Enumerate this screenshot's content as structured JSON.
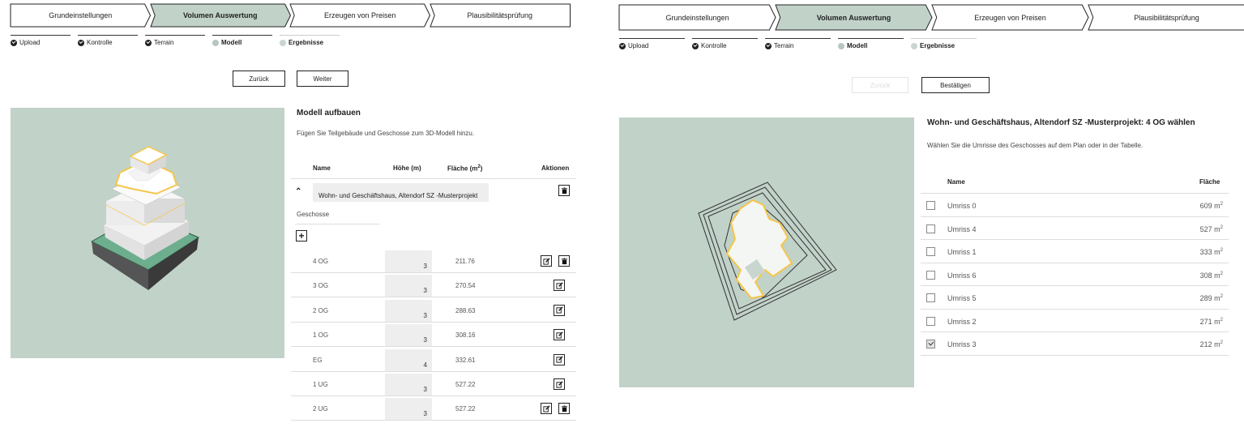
{
  "left": {
    "steps": [
      "Grundeinstellungen",
      "Volumen Auswertung",
      "Erzeugen von Preisen",
      "Plausibilitätsprüfung"
    ],
    "substeps": [
      {
        "label": "Upload",
        "state": "done"
      },
      {
        "label": "Kontrolle",
        "state": "done"
      },
      {
        "label": "Terrain",
        "state": "done"
      },
      {
        "label": "Modell",
        "state": "current"
      },
      {
        "label": "Ergebnisse",
        "state": "pending"
      }
    ],
    "back_label": "Zurück",
    "next_label": "Weiter",
    "title": "Modell aufbauen",
    "description": "Fügen Sie Teilgebäude und Geschosse zum 3D-Modell hinzu.",
    "columns": {
      "name": "Name",
      "height": "Höhe (m)",
      "area": "Fläche (m",
      "area_sup": "2",
      "area_close": ")",
      "actions": "Aktionen"
    },
    "building_name": "Wohn- und Geschäftshaus, Altendorf SZ -Musterprojekt",
    "floors_label": "Geschosse",
    "floors": [
      {
        "name": "4 OG",
        "height": "3",
        "area": "211.76",
        "delete": true
      },
      {
        "name": "3 OG",
        "height": "3",
        "area": "270.54",
        "delete": false
      },
      {
        "name": "2 OG",
        "height": "3",
        "area": "288.63",
        "delete": false
      },
      {
        "name": "1 OG",
        "height": "3",
        "area": "308.16",
        "delete": false
      },
      {
        "name": "EG",
        "height": "4",
        "area": "332.61",
        "delete": false
      },
      {
        "name": "1 UG",
        "height": "3",
        "area": "527.22",
        "delete": false
      },
      {
        "name": "2 UG",
        "height": "3",
        "area": "527.22",
        "delete": true
      }
    ]
  },
  "right": {
    "steps": [
      "Grundeinstellungen",
      "Volumen Auswertung",
      "Erzeugen von Preisen",
      "Plausibilitätsprüfung"
    ],
    "substeps": [
      {
        "label": "Upload",
        "state": "done"
      },
      {
        "label": "Kontrolle",
        "state": "done"
      },
      {
        "label": "Terrain",
        "state": "done"
      },
      {
        "label": "Modell",
        "state": "current"
      },
      {
        "label": "Ergebnisse",
        "state": "pending"
      }
    ],
    "back_label": "Zurück",
    "confirm_label": "Bestätigen",
    "title": "Wohn- und Geschäftshaus, Altendorf SZ -Musterprojekt: 4 OG wählen",
    "description": "Wählen Sie die Umrisse des Geschosses auf dem Plan oder in der Tabelle.",
    "columns": {
      "name": "Name",
      "area": "Fläche"
    },
    "unit": "m",
    "unit_sup": "2",
    "outlines": [
      {
        "name": "Umriss 0",
        "area": "609",
        "checked": false
      },
      {
        "name": "Umriss 4",
        "area": "527",
        "checked": false
      },
      {
        "name": "Umriss 1",
        "area": "333",
        "checked": false
      },
      {
        "name": "Umriss 6",
        "area": "308",
        "checked": false
      },
      {
        "name": "Umriss 5",
        "area": "289",
        "checked": false
      },
      {
        "name": "Umriss 2",
        "area": "271",
        "checked": false
      },
      {
        "name": "Umriss 3",
        "area": "212",
        "checked": true
      }
    ]
  },
  "colors": {
    "accent": "#c1d2c9",
    "active_step": "#c1d2c9",
    "highlight": "#f5c64a"
  }
}
